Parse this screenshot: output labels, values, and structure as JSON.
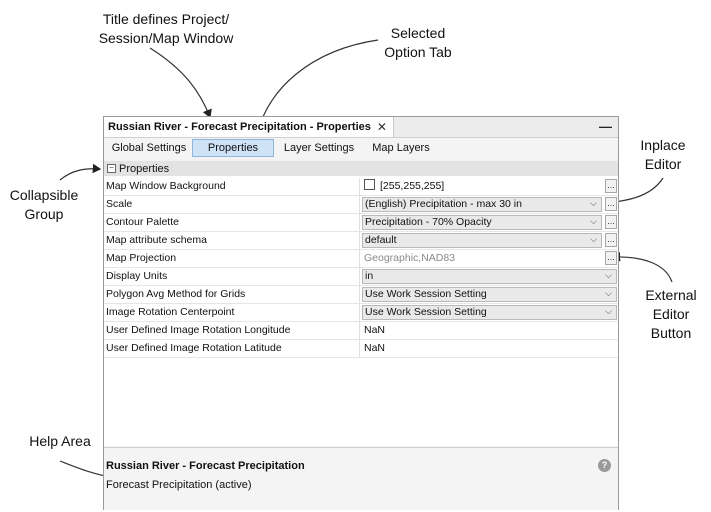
{
  "annotations": {
    "title_note": "Title defines Project/\nSession/Map Window",
    "tab_note": "Selected\nOption Tab",
    "inplace_note": "Inplace\nEditor",
    "collapsible_note": "Collapsible\nGroup",
    "external_note": "External\nEditor\nButton",
    "help_note": "Help Area"
  },
  "window": {
    "title": "Russian River - Forecast Precipitation - Properties",
    "close_glyph": "✕",
    "minimize_glyph": "—"
  },
  "tabs": [
    {
      "label": "Global Settings",
      "selected": false
    },
    {
      "label": "Properties",
      "selected": true
    },
    {
      "label": "Layer Settings",
      "selected": false
    },
    {
      "label": "Map Layers",
      "selected": false
    }
  ],
  "group": {
    "label": "Properties",
    "collapse_glyph": "−"
  },
  "rows": [
    {
      "name": "Map Window Background",
      "value": "[255,255,255]"
    },
    {
      "name": "Scale",
      "value": "(English) Precipitation - max 30 in"
    },
    {
      "name": "Contour Palette",
      "value": "Precipitation - 70% Opacity"
    },
    {
      "name": "Map attribute schema",
      "value": "default"
    },
    {
      "name": "Map Projection",
      "value": "Geographic,NAD83"
    },
    {
      "name": "Display Units",
      "value": "in"
    },
    {
      "name": "Polygon Avg Method for Grids",
      "value": "Use Work Session Setting"
    },
    {
      "name": "Image Rotation Centerpoint",
      "value": "Use Work Session Setting"
    },
    {
      "name": "User Defined Image Rotation Longitude",
      "value": "NaN"
    },
    {
      "name": "User Defined Image Rotation Latitude",
      "value": "NaN"
    }
  ],
  "help": {
    "title": "Russian River - Forecast Precipitation",
    "description": "Forecast Precipitation (active)",
    "icon": "help-icon"
  },
  "glyphs": {
    "chevron": "⌵",
    "ellipsis": "..."
  },
  "colors": {
    "selected_tab": "#cfe3f7",
    "group_header": "#e3e3e3",
    "panel_bg": "#f2f2f2"
  }
}
